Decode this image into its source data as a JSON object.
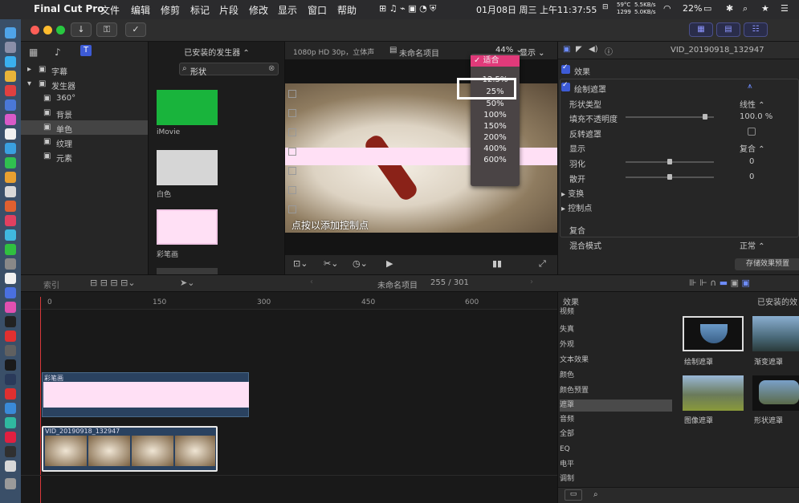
{
  "menubar": {
    "app": "Final Cut Pro",
    "items": [
      "文件",
      "编辑",
      "修剪",
      "标记",
      "片段",
      "修改",
      "显示",
      "窗口",
      "帮助"
    ],
    "datetime": "01月08日 周三 上午11:37:55",
    "net_up": "5.5KB/s",
    "net_down": "5.0KB/s",
    "temp": "59°C",
    "fan": "1299",
    "battery": "22%"
  },
  "libraries": {
    "items": [
      {
        "label": "字幕"
      },
      {
        "label": "发生器"
      },
      {
        "label": "360°"
      },
      {
        "label": "背景"
      },
      {
        "label": "单色"
      },
      {
        "label": "纹理"
      },
      {
        "label": "元素"
      }
    ]
  },
  "browser": {
    "title": "已安装的发生器 ⌃",
    "search": "形状",
    "clips": [
      {
        "label": "iMovie",
        "color": "#19b43c"
      },
      {
        "label": "白色",
        "color": "#d6d6d6"
      },
      {
        "label": "彩笔画",
        "color": "#ffe0f5"
      }
    ]
  },
  "viewer": {
    "format": "1080p HD 30p，立体声",
    "project": "未命名项目",
    "zoom": "44% ⌄",
    "view": "显示 ⌄",
    "overlay_text": "点按以添加控制点"
  },
  "zoom_menu": {
    "items": [
      "适合",
      "12.5%",
      "25%",
      "50%",
      "100%",
      "150%",
      "200%",
      "400%",
      "600%"
    ],
    "selected": "适合"
  },
  "inspector": {
    "title": "VID_20190918_132947",
    "effects_label": "效果",
    "effect_name": "绘制遮罩",
    "rows": [
      {
        "k": "形状类型",
        "v": "线性 ⌃"
      },
      {
        "k": "填充不透明度",
        "v": "100.0 %",
        "s": 0.92
      },
      {
        "k": "反转遮罩",
        "v": ""
      },
      {
        "k": "显示",
        "v": "复合 ⌃"
      },
      {
        "k": "羽化",
        "v": "0",
        "s": 0.5
      },
      {
        "k": "散开",
        "v": "0",
        "s": 0.5
      },
      {
        "k": "▸ 变换",
        "v": ""
      },
      {
        "k": "▸ 控制点",
        "v": ""
      }
    ],
    "composite": "复合",
    "blend_label": "混合模式",
    "blend_value": "正常 ⌃",
    "save_preset": "存储效果预置"
  },
  "timeline_bar": {
    "index": "索引",
    "project": "未命名项目",
    "timecode": "255 / 301"
  },
  "timeline": {
    "ticks": [
      "0",
      "150",
      "300",
      "450",
      "600"
    ],
    "title_clip": "彩笔画",
    "video_clip": "VID_20190918_132947"
  },
  "effects": {
    "header": "效果",
    "installed": "已安装的效",
    "categories": [
      "视频",
      "失真",
      "外观",
      "文本效果",
      "颜色",
      "颜色预置",
      "遮罩",
      "音频",
      "全部",
      "EQ",
      "电平",
      "调制"
    ],
    "selected": "遮罩",
    "items": [
      {
        "label": "绘制遮罩"
      },
      {
        "label": "渐变遮罩"
      },
      {
        "label": "图像遮罩"
      },
      {
        "label": "形状遮罩"
      }
    ]
  }
}
